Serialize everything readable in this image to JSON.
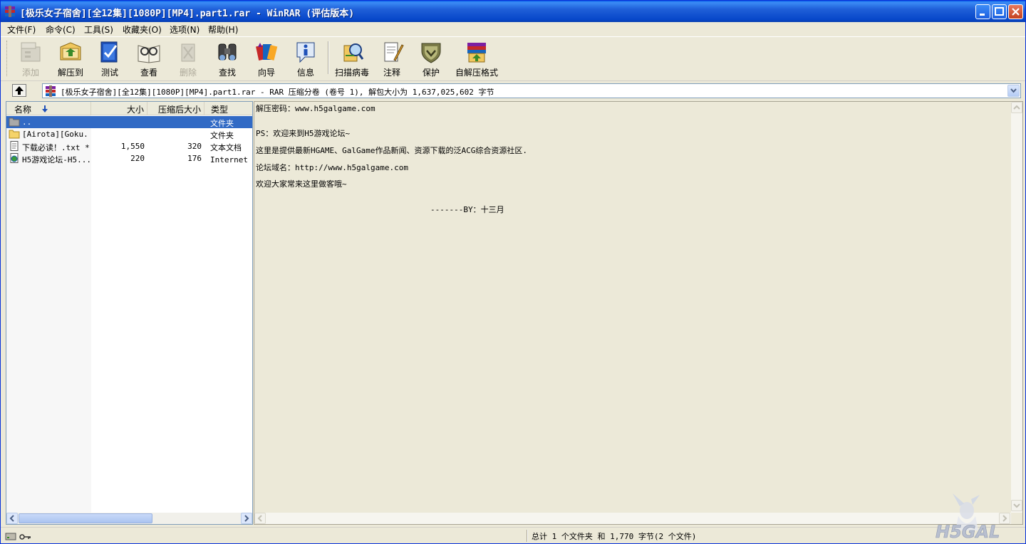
{
  "window": {
    "title": "[极乐女子宿舍][全12集][1080P][MP4].part1.rar - WinRAR (评估版本)"
  },
  "menu": [
    "文件(F)",
    "命令(C)",
    "工具(S)",
    "收藏夹(O)",
    "选项(N)",
    "帮助(H)"
  ],
  "toolbar": {
    "add": "添加",
    "extract": "解压到",
    "test": "测试",
    "view": "查看",
    "delete": "删除",
    "find": "查找",
    "wizard": "向导",
    "info": "信息",
    "scan": "扫描病毒",
    "comment": "注释",
    "protect": "保护",
    "sfx": "自解压格式"
  },
  "address": {
    "text": "[极乐女子宿舍][全12集][1080P][MP4].part1.rar - RAR 压缩分卷 (卷号 1), 解包大小为 1,637,025,602 字节"
  },
  "filelist": {
    "headers": {
      "name": "名称",
      "size": "大小",
      "packed": "压缩后大小",
      "type": "类型"
    },
    "rows": [
      {
        "name": "..",
        "size": "",
        "packed": "",
        "type": "文件夹"
      },
      {
        "name": "[Airota][Goku...",
        "size": "",
        "packed": "",
        "type": "文件夹"
      },
      {
        "name": "下载必读！.txt *",
        "size": "1,550",
        "packed": "320",
        "type": "文本文档"
      },
      {
        "name": "H5游戏论坛-H5...",
        "size": "220",
        "packed": "176",
        "type": "Internet 快捷方式"
      }
    ]
  },
  "comment": {
    "lines": [
      "解压密码：www.h5galgame.com",
      "PS：欢迎来到H5游戏论坛~",
      "这里是提供最新HGAME、GalGame作品新闻、资源下载的泛ACG综合资源社区.",
      "论坛域名：http://www.h5galgame.com",
      "欢迎大家常来这里做客哦~",
      "-------BY：十三月"
    ]
  },
  "status": {
    "text": "总计 1 个文件夹 和 1,770 字节(2 个文件)"
  },
  "watermark": {
    "text": "H5GAL"
  },
  "colors": {
    "titlebar": "#0a5fe8",
    "selection": "#316ac5",
    "face": "#ece9d8"
  }
}
